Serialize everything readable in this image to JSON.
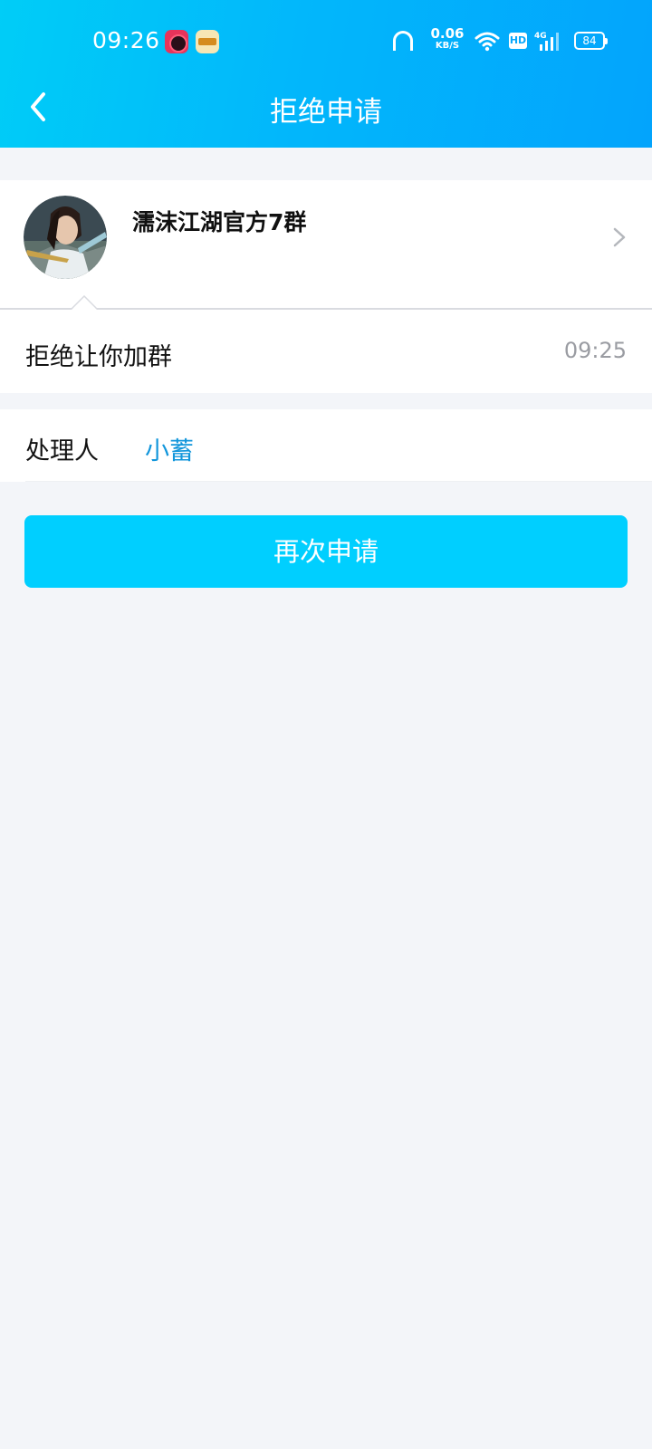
{
  "status_bar": {
    "time": "09:26",
    "net_speed_value": "0.06",
    "net_speed_unit": "KB/S",
    "hd_label": "HD",
    "network_type": "4G",
    "battery_level": "84"
  },
  "header": {
    "title": "拒绝申请"
  },
  "group": {
    "name": "濡沫江湖官方7群"
  },
  "message": {
    "text": "拒绝让你加群",
    "time": "09:25"
  },
  "handler": {
    "label": "处理人",
    "name": "小蓄"
  },
  "actions": {
    "reapply_label": "再次申请"
  },
  "colors": {
    "header_gradient_start": "#00cdf7",
    "header_gradient_end": "#03a4fc",
    "button": "#00cfff",
    "link": "#1296db",
    "background": "#f3f5f9"
  }
}
